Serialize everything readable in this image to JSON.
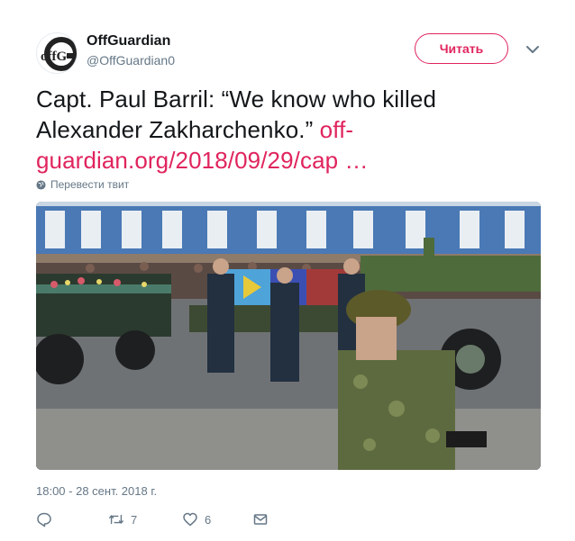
{
  "author": {
    "display_name": "OffGuardian",
    "handle": "@OffGuardian0",
    "avatar_text": "offG"
  },
  "follow_button": {
    "label": "Читать"
  },
  "tweet": {
    "text": "Capt. Paul Barril: “We know who killed Alexander Zakharchenko.” ",
    "link": "off-guardian.org/2018/09/29/cap …",
    "translate_label": "Перевести твит"
  },
  "timestamp": "18:00 - 28 сент. 2018 г.",
  "actions": {
    "reply_icon": "reply-icon",
    "retweet_icon": "retweet-icon",
    "retweet_count": "7",
    "like_icon": "heart-icon",
    "like_count": "6",
    "dm_icon": "envelope-icon"
  },
  "colors": {
    "accent": "#e0245e",
    "text": "#14171a",
    "muted": "#657786"
  }
}
